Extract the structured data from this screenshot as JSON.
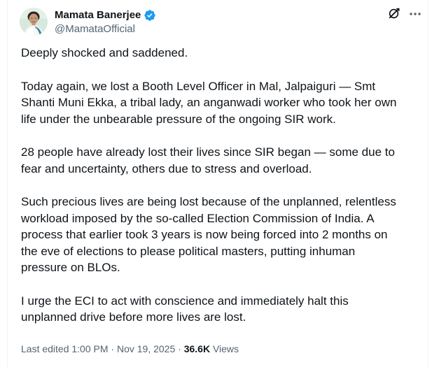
{
  "author": {
    "display_name": "Mamata Banerjee",
    "handle": "@MamataOfficial",
    "verified": true
  },
  "header_icons": {
    "grok": "grok-icon",
    "more": "more-options-icon"
  },
  "post": {
    "paragraphs": [
      "Deeply shocked and saddened.",
      "Today again, we lost a Booth Level Officer in Mal, Jalpaiguri — Smt\nShanti Muni Ekka, a tribal lady, an anganwadi worker who took her own\nlife under the unbearable pressure of the ongoing SIR work.",
      "28 people have already lost their lives since SIR began — some due to\nfear and uncertainty, others due to stress and overload.",
      "Such precious lives are being lost because of the unplanned, relentless\nworkload imposed by the so-called Election Commission of India. A\nprocess that earlier took 3 years is now being forced into 2 months on\nthe eve of elections to please political masters, putting inhuman\npressure on BLOs.",
      "I urge the ECI to act with conscience and immediately halt this\nunplanned drive before more lives are lost."
    ]
  },
  "meta": {
    "edited_timestamp": "Last edited 1:00 PM · Nov 19, 2025 · ",
    "views_count": "36.6K",
    "views_label": " Views"
  },
  "colors": {
    "text_primary": "#0f1419",
    "text_secondary": "#536471",
    "verified_badge": "#1d9bf0",
    "border": "#eff3f4"
  }
}
